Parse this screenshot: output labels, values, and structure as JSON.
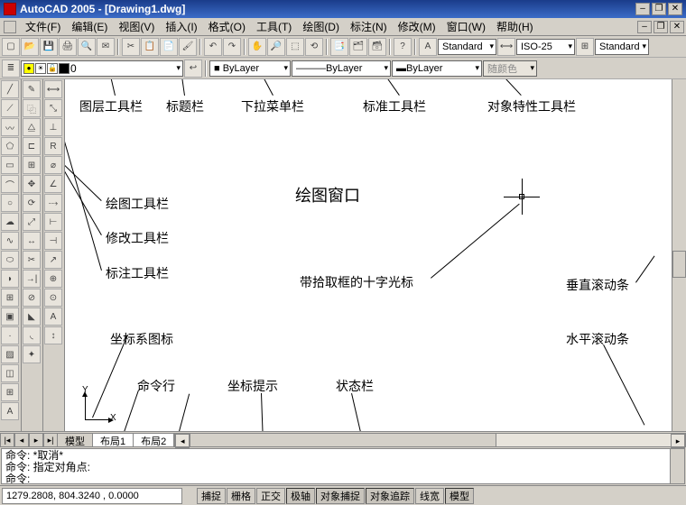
{
  "titlebar": {
    "title": "AutoCAD 2005 - [Drawing1.dwg]"
  },
  "menu": {
    "file": "文件(F)",
    "edit": "编辑(E)",
    "view": "视图(V)",
    "insert": "插入(I)",
    "format": "格式(O)",
    "tools": "工具(T)",
    "draw": "绘图(D)",
    "dim": "标注(N)",
    "modify": "修改(M)",
    "window": "窗口(W)",
    "help": "帮助(H)"
  },
  "toolbar1": {
    "styles": {
      "text": "Standard",
      "dim": "ISO-25",
      "table": "Standard"
    }
  },
  "toolbar2": {
    "layer": "0",
    "color": "■ ByLayer",
    "linetype": "ByLayer",
    "lineweight": "ByLayer",
    "otherColor": "随颜色"
  },
  "tabs": {
    "model": "模型",
    "layout1": "布局1",
    "layout2": "布局2"
  },
  "cmd": {
    "line1": "命令: *取消*",
    "line2": "命令: 指定对角点:",
    "line3": "命令:"
  },
  "status": {
    "coords": "1279.2808, 804.3240 , 0.0000",
    "snap": "捕捉",
    "grid": "栅格",
    "ortho": "正交",
    "polar": "极轴",
    "osnap": "对象捕捉",
    "otrack": "对象追踪",
    "lwt": "线宽",
    "model": "模型"
  },
  "ucs": {
    "y": "Y",
    "x": "X"
  },
  "annot": {
    "layer_tb": "图层工具栏",
    "title_bar": "标题栏",
    "menu_bar": "下拉菜单栏",
    "std_tb": "标准工具栏",
    "prop_tb": "对象特性工具栏",
    "draw_tb": "绘图工具栏",
    "mod_tb": "修改工具栏",
    "dim_tb": "标注工具栏",
    "draw_win": "绘图窗口",
    "cursor": "带拾取框的十字光标",
    "vscroll": "垂直滚动条",
    "hscroll": "水平滚动条",
    "ucs_icon": "坐标系图标",
    "cmdline": "命令行",
    "coord_prompt": "坐标提示",
    "status_bar": "状态栏"
  }
}
